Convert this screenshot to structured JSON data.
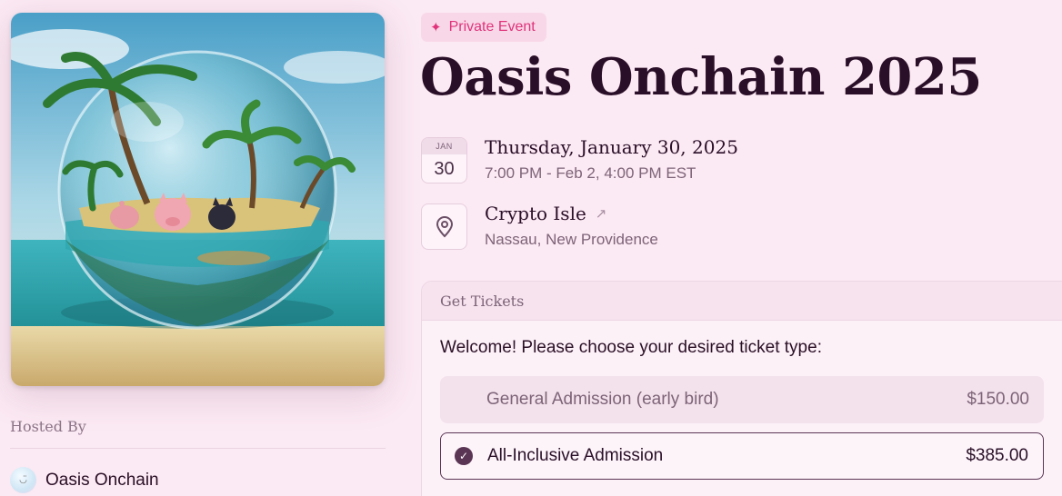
{
  "event": {
    "badge_icon": "sparkle-icon",
    "badge_label": "Private Event",
    "title": "Oasis Onchain 2025"
  },
  "date": {
    "icon_month": "JAN",
    "icon_day": "30",
    "title": "Thursday, January 30, 2025",
    "time_range": "7:00 PM - Feb 2, 4:00 PM EST"
  },
  "location": {
    "icon": "map-pin-icon",
    "name": "Crypto Isle",
    "link_icon": "arrow-up-right-icon",
    "region": "Nassau, New Providence"
  },
  "host": {
    "label": "Hosted By",
    "name": "Oasis Onchain",
    "avatar_glyph": "◡̈"
  },
  "tickets": {
    "header": "Get Tickets",
    "intro": "Welcome! Please choose your desired ticket type:",
    "options": [
      {
        "name": "General Admission (early bird)",
        "price": "$150.00",
        "selected": false
      },
      {
        "name": "All-Inclusive Admission",
        "price": "$385.00",
        "selected": true
      }
    ]
  },
  "colors": {
    "background": "#fbe9f3",
    "accent": "#e0337a",
    "title": "#2a0f28",
    "selected_border": "#5a3554"
  }
}
